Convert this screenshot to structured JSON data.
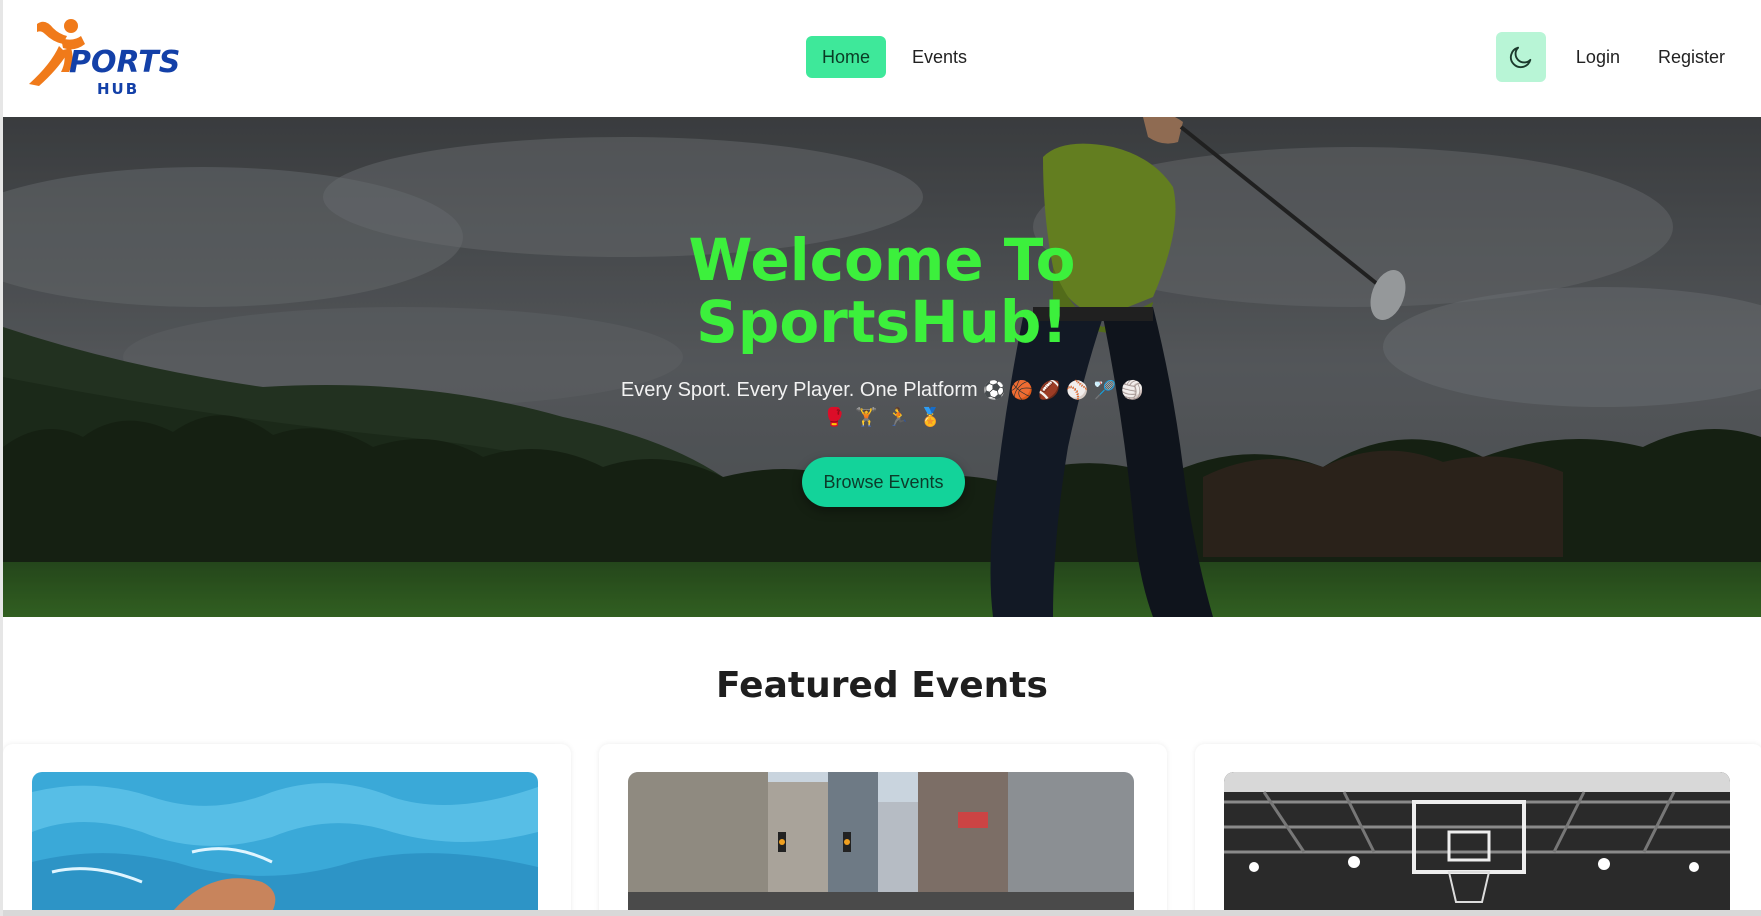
{
  "logo": {
    "main": "PORTS",
    "sub": "HUB",
    "colors": {
      "orange": "#f07a1a",
      "blue": "#1340a8"
    }
  },
  "nav": {
    "links": [
      {
        "label": "Home",
        "active": true
      },
      {
        "label": "Events",
        "active": false
      }
    ],
    "theme_icon": "moon-icon",
    "login_label": "Login",
    "register_label": "Register"
  },
  "hero": {
    "title_line1": "Welcome To",
    "title_line2": "SportsHub!",
    "subtitle": "Every Sport. Every Player. One Platform",
    "subtitle_emojis": [
      "⚽",
      "🏀",
      "🏈",
      "⚾",
      "🏸",
      "🏐"
    ],
    "emojis_row2": [
      "🥊",
      "🏋",
      "🏃",
      "🏅"
    ],
    "button_label": "Browse Events"
  },
  "featured": {
    "title": "Featured Events",
    "cards": [
      {
        "image": "swimming-image"
      },
      {
        "image": "city-street-image"
      },
      {
        "image": "basketball-court-image"
      }
    ]
  },
  "colors": {
    "accent": "#3ee89a",
    "title_green": "#3cf03c",
    "button": "#13d39a"
  }
}
